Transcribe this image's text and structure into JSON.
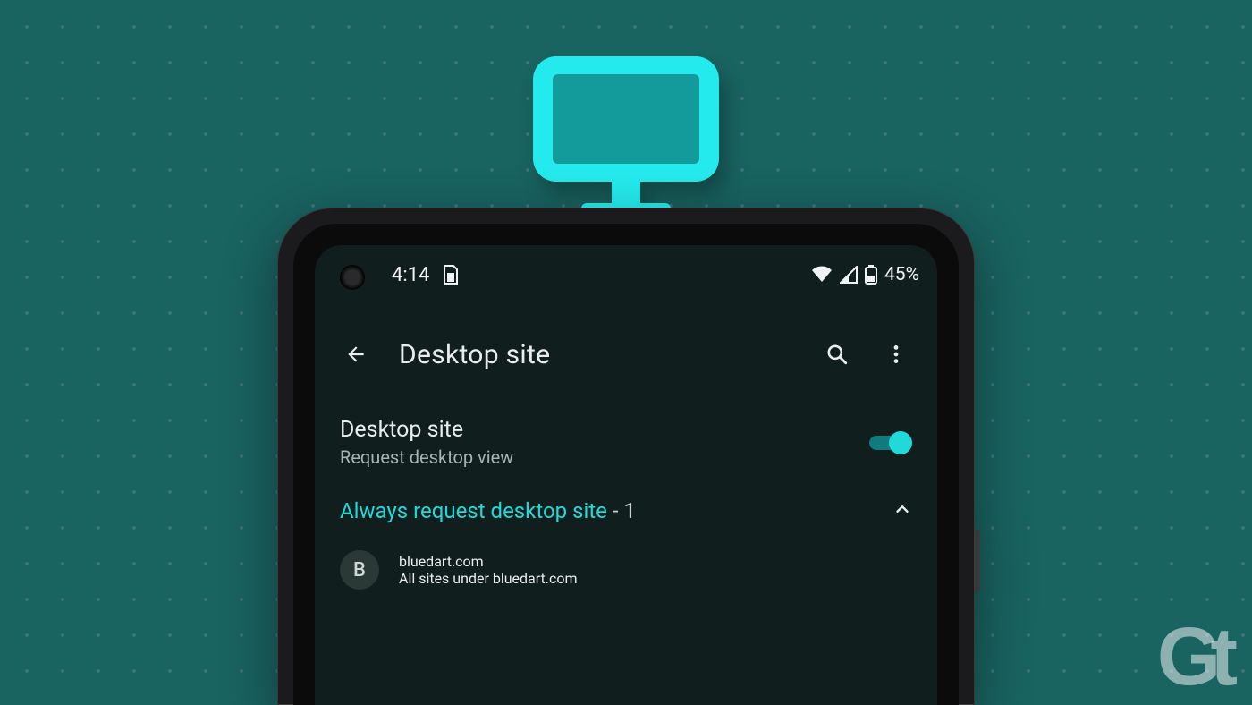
{
  "statusbar": {
    "time": "4:14",
    "battery_text": "45%"
  },
  "appbar": {
    "title": "Desktop site"
  },
  "settings": {
    "desktop_toggle": {
      "title": "Desktop site",
      "subtitle": "Request desktop view",
      "enabled": true
    },
    "section": {
      "label": "Always request desktop site",
      "count_sep": " - ",
      "count": "1"
    },
    "sites": [
      {
        "badge_letter": "B",
        "domain": "bluedart.com",
        "subtitle": "All sites under bluedart.com"
      }
    ]
  },
  "watermark": {
    "a": "G",
    "b": "t"
  }
}
